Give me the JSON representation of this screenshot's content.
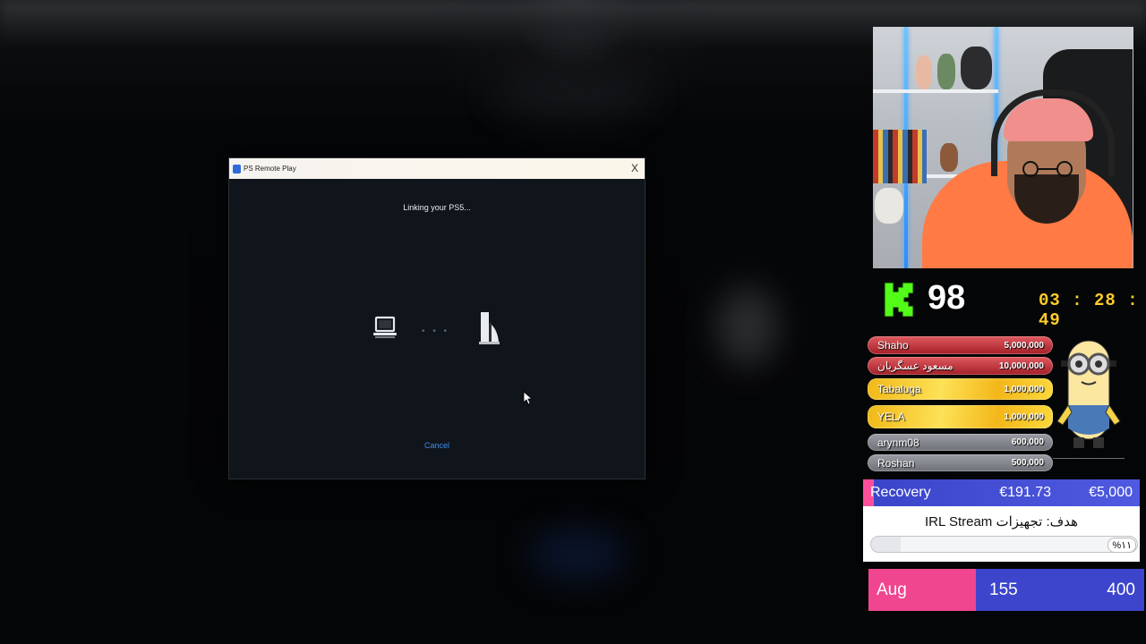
{
  "dialog": {
    "app_title": "PS Remote Play",
    "close_label": "X",
    "status": "Linking your PS5...",
    "dots": "• • •",
    "cancel_label": "Cancel"
  },
  "stream": {
    "viewer_count": "98",
    "timer": "03 : 28 : 49"
  },
  "donors": [
    {
      "name": "Shaho",
      "amount": "5,000,000",
      "style": "red"
    },
    {
      "name": "مسعود عسگریان",
      "amount": "10,000,000",
      "style": "red"
    },
    {
      "name": "Tabaluga",
      "amount": "1,000,000",
      "style": "gold"
    },
    {
      "name": "YELA",
      "amount": "1,000,000",
      "style": "gold"
    },
    {
      "name": "arynm08",
      "amount": "600,000",
      "style": "gray"
    },
    {
      "name": "Roshan",
      "amount": "500,000",
      "style": "gray"
    }
  ],
  "goals": {
    "recovery": {
      "label": "Recovery",
      "current": "€191.73",
      "target": "€5,000",
      "progress": 0.038
    },
    "irl": {
      "title": "هدف: تجهیزات IRL Stream",
      "percent_label": "%۱۱",
      "progress": 0.11
    },
    "aug": {
      "label": "Aug",
      "current": "155",
      "target": "400"
    }
  },
  "colors": {
    "kick_green": "#53fc18",
    "timer_yellow": "#ffcc2a",
    "link_blue": "#3a8ff0",
    "pink": "#f0458f",
    "indigo": "#3c45cc"
  },
  "icons": [
    "laptop-icon",
    "ps5-console-icon",
    "kick-logo-icon",
    "mouse-cursor-icon",
    "minion-mascot-icon"
  ]
}
